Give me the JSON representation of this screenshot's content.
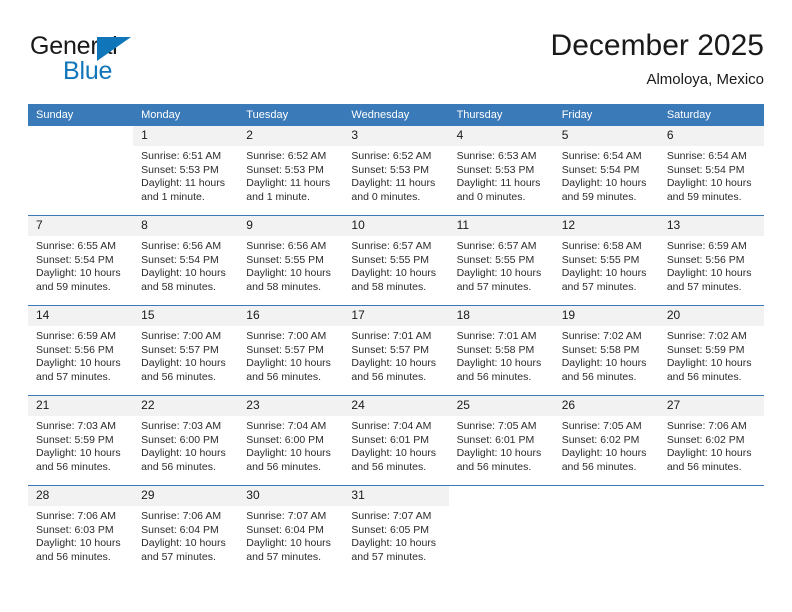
{
  "brand": {
    "name_part1": "General",
    "name_part2": "Blue",
    "flag_icon": "brand-flag-icon",
    "accent_color": "#1175ba"
  },
  "header": {
    "title": "December 2025",
    "subtitle": "Almoloya, Mexico"
  },
  "calendar": {
    "header_color": "#3a7ab8",
    "weekdays": [
      "Sunday",
      "Monday",
      "Tuesday",
      "Wednesday",
      "Thursday",
      "Friday",
      "Saturday"
    ],
    "weeks": [
      [
        {
          "day": "",
          "sunrise": "",
          "sunset": "",
          "daylight": ""
        },
        {
          "day": "1",
          "sunrise": "Sunrise: 6:51 AM",
          "sunset": "Sunset: 5:53 PM",
          "daylight": "Daylight: 11 hours and 1 minute."
        },
        {
          "day": "2",
          "sunrise": "Sunrise: 6:52 AM",
          "sunset": "Sunset: 5:53 PM",
          "daylight": "Daylight: 11 hours and 1 minute."
        },
        {
          "day": "3",
          "sunrise": "Sunrise: 6:52 AM",
          "sunset": "Sunset: 5:53 PM",
          "daylight": "Daylight: 11 hours and 0 minutes."
        },
        {
          "day": "4",
          "sunrise": "Sunrise: 6:53 AM",
          "sunset": "Sunset: 5:53 PM",
          "daylight": "Daylight: 11 hours and 0 minutes."
        },
        {
          "day": "5",
          "sunrise": "Sunrise: 6:54 AM",
          "sunset": "Sunset: 5:54 PM",
          "daylight": "Daylight: 10 hours and 59 minutes."
        },
        {
          "day": "6",
          "sunrise": "Sunrise: 6:54 AM",
          "sunset": "Sunset: 5:54 PM",
          "daylight": "Daylight: 10 hours and 59 minutes."
        }
      ],
      [
        {
          "day": "7",
          "sunrise": "Sunrise: 6:55 AM",
          "sunset": "Sunset: 5:54 PM",
          "daylight": "Daylight: 10 hours and 59 minutes."
        },
        {
          "day": "8",
          "sunrise": "Sunrise: 6:56 AM",
          "sunset": "Sunset: 5:54 PM",
          "daylight": "Daylight: 10 hours and 58 minutes."
        },
        {
          "day": "9",
          "sunrise": "Sunrise: 6:56 AM",
          "sunset": "Sunset: 5:55 PM",
          "daylight": "Daylight: 10 hours and 58 minutes."
        },
        {
          "day": "10",
          "sunrise": "Sunrise: 6:57 AM",
          "sunset": "Sunset: 5:55 PM",
          "daylight": "Daylight: 10 hours and 58 minutes."
        },
        {
          "day": "11",
          "sunrise": "Sunrise: 6:57 AM",
          "sunset": "Sunset: 5:55 PM",
          "daylight": "Daylight: 10 hours and 57 minutes."
        },
        {
          "day": "12",
          "sunrise": "Sunrise: 6:58 AM",
          "sunset": "Sunset: 5:55 PM",
          "daylight": "Daylight: 10 hours and 57 minutes."
        },
        {
          "day": "13",
          "sunrise": "Sunrise: 6:59 AM",
          "sunset": "Sunset: 5:56 PM",
          "daylight": "Daylight: 10 hours and 57 minutes."
        }
      ],
      [
        {
          "day": "14",
          "sunrise": "Sunrise: 6:59 AM",
          "sunset": "Sunset: 5:56 PM",
          "daylight": "Daylight: 10 hours and 57 minutes."
        },
        {
          "day": "15",
          "sunrise": "Sunrise: 7:00 AM",
          "sunset": "Sunset: 5:57 PM",
          "daylight": "Daylight: 10 hours and 56 minutes."
        },
        {
          "day": "16",
          "sunrise": "Sunrise: 7:00 AM",
          "sunset": "Sunset: 5:57 PM",
          "daylight": "Daylight: 10 hours and 56 minutes."
        },
        {
          "day": "17",
          "sunrise": "Sunrise: 7:01 AM",
          "sunset": "Sunset: 5:57 PM",
          "daylight": "Daylight: 10 hours and 56 minutes."
        },
        {
          "day": "18",
          "sunrise": "Sunrise: 7:01 AM",
          "sunset": "Sunset: 5:58 PM",
          "daylight": "Daylight: 10 hours and 56 minutes."
        },
        {
          "day": "19",
          "sunrise": "Sunrise: 7:02 AM",
          "sunset": "Sunset: 5:58 PM",
          "daylight": "Daylight: 10 hours and 56 minutes."
        },
        {
          "day": "20",
          "sunrise": "Sunrise: 7:02 AM",
          "sunset": "Sunset: 5:59 PM",
          "daylight": "Daylight: 10 hours and 56 minutes."
        }
      ],
      [
        {
          "day": "21",
          "sunrise": "Sunrise: 7:03 AM",
          "sunset": "Sunset: 5:59 PM",
          "daylight": "Daylight: 10 hours and 56 minutes."
        },
        {
          "day": "22",
          "sunrise": "Sunrise: 7:03 AM",
          "sunset": "Sunset: 6:00 PM",
          "daylight": "Daylight: 10 hours and 56 minutes."
        },
        {
          "day": "23",
          "sunrise": "Sunrise: 7:04 AM",
          "sunset": "Sunset: 6:00 PM",
          "daylight": "Daylight: 10 hours and 56 minutes."
        },
        {
          "day": "24",
          "sunrise": "Sunrise: 7:04 AM",
          "sunset": "Sunset: 6:01 PM",
          "daylight": "Daylight: 10 hours and 56 minutes."
        },
        {
          "day": "25",
          "sunrise": "Sunrise: 7:05 AM",
          "sunset": "Sunset: 6:01 PM",
          "daylight": "Daylight: 10 hours and 56 minutes."
        },
        {
          "day": "26",
          "sunrise": "Sunrise: 7:05 AM",
          "sunset": "Sunset: 6:02 PM",
          "daylight": "Daylight: 10 hours and 56 minutes."
        },
        {
          "day": "27",
          "sunrise": "Sunrise: 7:06 AM",
          "sunset": "Sunset: 6:02 PM",
          "daylight": "Daylight: 10 hours and 56 minutes."
        }
      ],
      [
        {
          "day": "28",
          "sunrise": "Sunrise: 7:06 AM",
          "sunset": "Sunset: 6:03 PM",
          "daylight": "Daylight: 10 hours and 56 minutes."
        },
        {
          "day": "29",
          "sunrise": "Sunrise: 7:06 AM",
          "sunset": "Sunset: 6:04 PM",
          "daylight": "Daylight: 10 hours and 57 minutes."
        },
        {
          "day": "30",
          "sunrise": "Sunrise: 7:07 AM",
          "sunset": "Sunset: 6:04 PM",
          "daylight": "Daylight: 10 hours and 57 minutes."
        },
        {
          "day": "31",
          "sunrise": "Sunrise: 7:07 AM",
          "sunset": "Sunset: 6:05 PM",
          "daylight": "Daylight: 10 hours and 57 minutes."
        },
        {
          "day": "",
          "sunrise": "",
          "sunset": "",
          "daylight": ""
        },
        {
          "day": "",
          "sunrise": "",
          "sunset": "",
          "daylight": ""
        },
        {
          "day": "",
          "sunrise": "",
          "sunset": "",
          "daylight": ""
        }
      ]
    ]
  }
}
